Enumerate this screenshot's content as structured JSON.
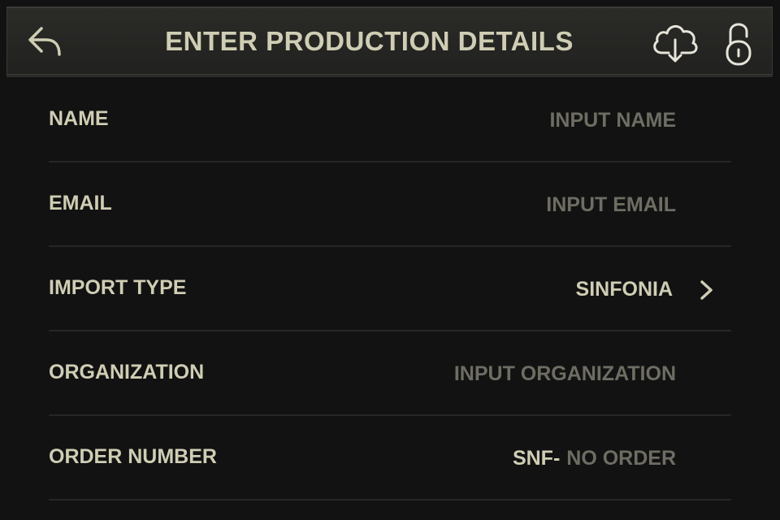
{
  "header": {
    "title": "ENTER PRODUCTION DETAILS",
    "back_icon": "back-arrow-icon",
    "cloud_icon": "cloud-download-icon",
    "lock_icon": "unlocked-padlock-icon"
  },
  "form": {
    "rows": [
      {
        "label": "NAME",
        "placeholder": "INPUT NAME"
      },
      {
        "label": "EMAIL",
        "placeholder": "INPUT EMAIL"
      },
      {
        "label": "IMPORT TYPE",
        "value": "SINFONIA"
      },
      {
        "label": "ORGANIZATION",
        "placeholder": "INPUT ORGANIZATION"
      },
      {
        "label": "ORDER NUMBER",
        "prefix": "SNF-",
        "placeholder": "NO ORDER"
      }
    ]
  },
  "colors": {
    "background": "#121212",
    "text_primary": "#cfcdb3",
    "text_placeholder": "#6e6d63",
    "divider": "#262624"
  }
}
